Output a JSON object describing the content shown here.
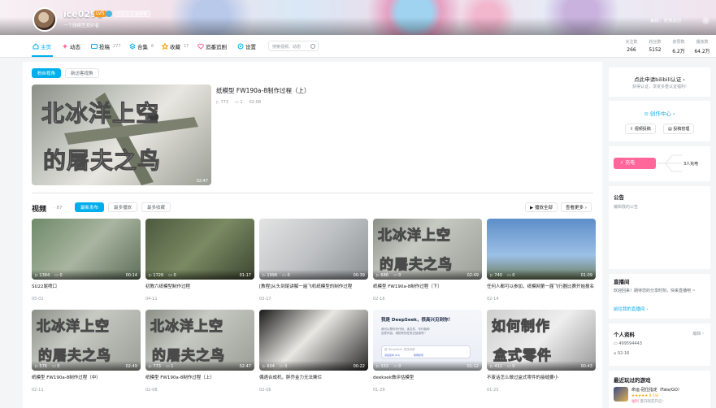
{
  "header": {
    "username": "ice0291",
    "level": "LV5",
    "badge1": "已关注",
    "badge2": "系统等",
    "signature": "一个抛模型爱好者",
    "banner_action": "装扮",
    "banner_action2": "更换装扮",
    "banner_chevron": "v"
  },
  "nav": {
    "items": [
      {
        "label": "主页",
        "count": ""
      },
      {
        "label": "动态",
        "count": ""
      },
      {
        "label": "投稿",
        "count": "277"
      },
      {
        "label": "合集",
        "count": "6"
      },
      {
        "label": "收藏",
        "count": "17"
      },
      {
        "label": "追番追剧",
        "count": ""
      },
      {
        "label": "设置",
        "count": ""
      }
    ],
    "search_placeholder": "搜索视频、动态"
  },
  "stats": [
    {
      "label": "关注数",
      "value": "266"
    },
    {
      "label": "粉丝数",
      "value": "5152"
    },
    {
      "label": "获赞数",
      "value": "6.2万"
    },
    {
      "label": "播放数",
      "value": "64.2万"
    }
  ],
  "featured": {
    "tabs": [
      "粉丝视角",
      "新访客视角"
    ],
    "title": "纸模型 FW190a-8制作过程（上）",
    "plays": "773",
    "comments": "1",
    "date": "02-08",
    "duration": "02:47",
    "overlay_line1": "北冰洋上空",
    "overlay_line2": "的屠夫之鸟"
  },
  "videos": {
    "heading": "视频",
    "count": "87",
    "sort_tabs": [
      "最新发布",
      "最多播放",
      "最多收藏"
    ],
    "play_all": "播放全部",
    "see_more": "查看更多 ›",
    "items": [
      {
        "title": "SU22尾喷口",
        "plays": "1384",
        "comments": "0",
        "duration": "00:14",
        "date": "05-01",
        "overlay": "",
        "overlay2": ""
      },
      {
        "title": "初教六纸模型制作过程",
        "plays": "1726",
        "comments": "0",
        "duration": "01:17",
        "date": "04-11",
        "overlay": "",
        "overlay2": ""
      },
      {
        "title": "[教程]从头到尾讲解一遍飞机纸模型的制作过程",
        "plays": "1996",
        "comments": "0",
        "duration": "00:39",
        "date": "03-17",
        "overlay": "",
        "overlay2": ""
      },
      {
        "title": "纸模型 FW190a-8制作过程（下）",
        "plays": "686",
        "comments": "0",
        "duration": "02:49",
        "date": "02-16",
        "overlay": "北冰洋上空",
        "overlay2": "的屠夫之鸟"
      },
      {
        "title": "任何人都可以参加，纸模网第一届飞行器比赛开始报名",
        "plays": "740",
        "comments": "0",
        "duration": "01:09",
        "date": "02-14",
        "overlay": "",
        "overlay2": ""
      },
      {
        "title": "纸模型 FW190a-8制作过程（中）",
        "plays": "576",
        "comments": "0",
        "duration": "02:49",
        "date": "02-11",
        "overlay": "北冰洋上空",
        "overlay2": "的屠夫之鸟"
      },
      {
        "title": "纸模型 FW190a-8制作过程（上）",
        "plays": "773",
        "comments": "1",
        "duration": "02:47",
        "date": "02-08",
        "overlay": "北冰洋上空",
        "overlay2": "的屠夫之鸟"
      },
      {
        "title": "偶遇合成机，胖乔金力无法撕烂",
        "plays": "604",
        "comments": "0",
        "duration": "00:22",
        "date": "02-06",
        "overlay": "",
        "overlay2": ""
      },
      {
        "title": "deeksek做评估模型",
        "plays": "333",
        "comments": "0",
        "duration": "01:12",
        "date": "01-29",
        "overlay": "",
        "overlay2": "",
        "card_line1": "我是 DeepSeek，很高兴见到你！",
        "card_line2": "我可以帮你写代码、读文件、写作各种创意内容，请把你的任务交给我吧~",
        "card_input": "给 DeepSeek 发送消息",
        "card_btn1": "深度思考 (R1)",
        "card_btn2": "联网搜索"
      },
      {
        "title": "不废话怎么做过盒式零件的接缝要小",
        "plays": "411",
        "comments": "0",
        "duration": "00:43",
        "date": "01-25",
        "overlay": "如何制作",
        "overlay2": "盒式零件"
      }
    ]
  },
  "sidebar": {
    "cert_title": "点此申请bilibili认证 ›",
    "cert_sub": "获得认证，享受多重认证福利!",
    "creator_center": "创作中心 ›",
    "video_submit": "视频投稿",
    "video_manage": "投稿管理",
    "charge_label": "充电",
    "charge_count": "3人充电",
    "notice_title": "公告",
    "notice_text": "编辑我的公告",
    "live_title": "直播间",
    "live_text": "欢迎回来！期待您的分享时刻，快来直播吧 ~",
    "live_link": "前往我的直播间 ›",
    "profile_title": "个人资料",
    "profile_edit": "编辑 ›",
    "uid": "499594443",
    "birthday": "02-16",
    "games_title": "最近玩过的游戏",
    "game_name": "命运-冠位指定（Fate/GO）",
    "game_rating": "★★★★★ 8.1分",
    "game_tag": "福利",
    "game_desc": "夏日限定开启!"
  },
  "colors": {
    "accent": "#00aeec",
    "charge": "#ff6699"
  }
}
